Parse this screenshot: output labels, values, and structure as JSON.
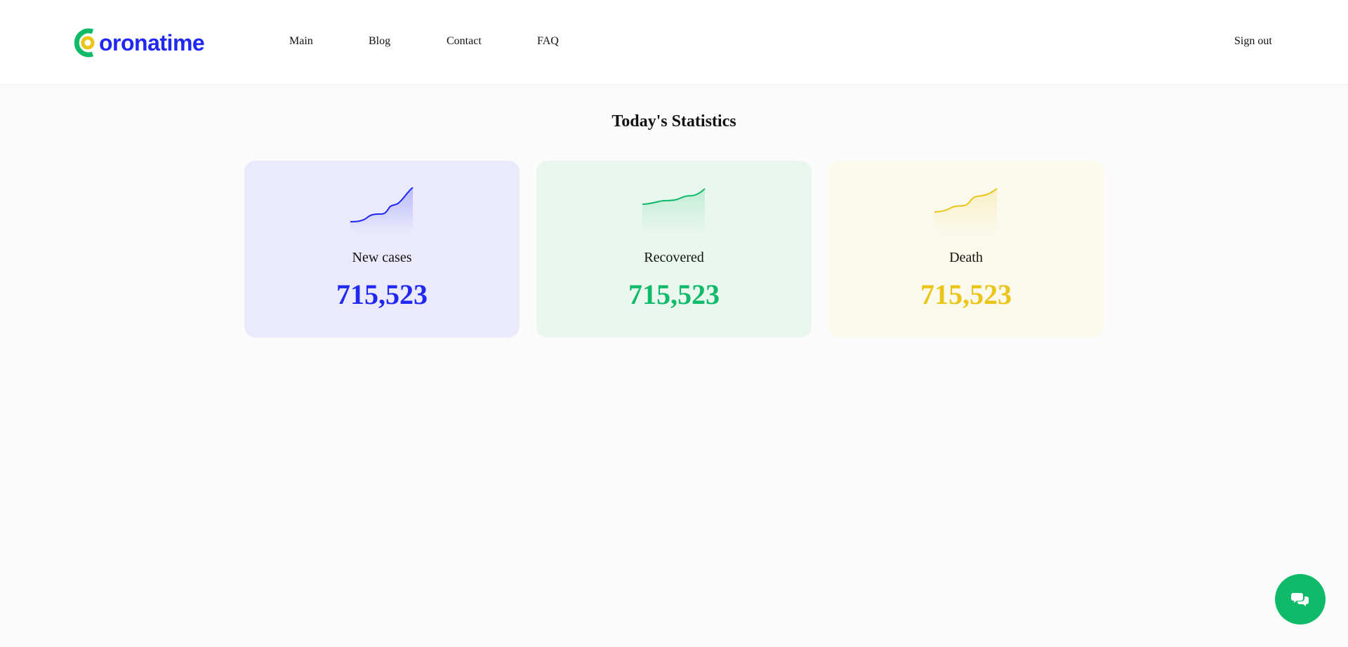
{
  "brand": {
    "name": "oronatime",
    "accent": "#2029f3",
    "ring_color": "#0fba68",
    "dot_color": "#eac517"
  },
  "nav": {
    "items": [
      {
        "label": "Main"
      },
      {
        "label": "Blog"
      },
      {
        "label": "Contact"
      },
      {
        "label": "FAQ"
      }
    ]
  },
  "header": {
    "signout_label": "Sign out"
  },
  "main": {
    "title": "Today's Statistics",
    "cards": [
      {
        "label": "New cases",
        "value": "715,523",
        "color": "#2029f3",
        "background": "#ebeafc",
        "icon": "line-chart-icon"
      },
      {
        "label": "Recovered",
        "value": "715,523",
        "color": "#0fba68",
        "background": "#e9f7ef",
        "icon": "line-chart-icon"
      },
      {
        "label": "Death",
        "value": "715,523",
        "color": "#eac517",
        "background": "#fbf9ec",
        "icon": "line-chart-icon"
      }
    ]
  },
  "chat": {
    "icon": "chat-bubbles-icon",
    "color": "#0fba68"
  }
}
